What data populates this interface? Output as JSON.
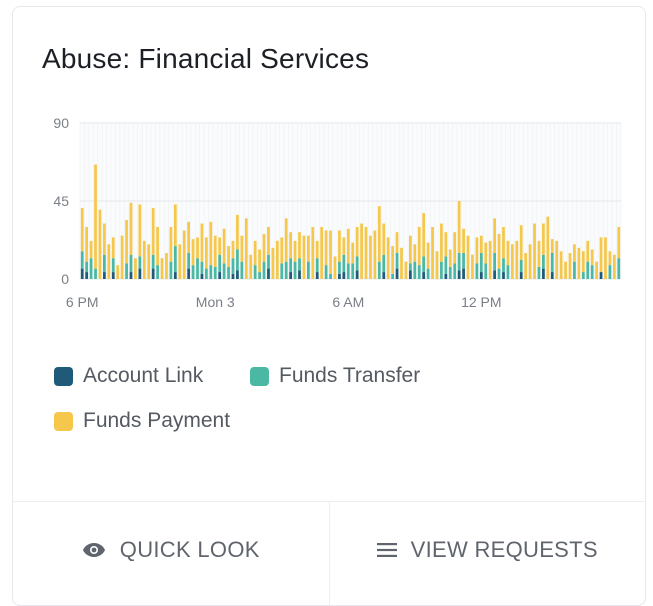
{
  "card": {
    "title": "Abuse: Financial Services"
  },
  "colors": {
    "account_link": "#1f5b78",
    "funds_transfer": "#4bb8a3",
    "funds_payment": "#f5c84c",
    "grid": "#eef0f3"
  },
  "legend": [
    {
      "label": "Account Link",
      "color": "#1f5b78"
    },
    {
      "label": "Funds Transfer",
      "color": "#4bb8a3"
    },
    {
      "label": "Funds Payment",
      "color": "#f5c84c"
    }
  ],
  "actions": {
    "quick_look": {
      "label": "QUICK LOOK",
      "icon": "eye-icon"
    },
    "view_requests": {
      "label": "VIEW REQUESTS",
      "icon": "list-icon"
    }
  },
  "chart_data": {
    "type": "bar",
    "stacked": true,
    "ylim": [
      0,
      90
    ],
    "yticks": [
      "0",
      "45",
      "90"
    ],
    "xticks": [
      {
        "label": "6 PM",
        "index": 0
      },
      {
        "label": "Mon 3",
        "index": 30
      },
      {
        "label": "6 AM",
        "index": 60
      },
      {
        "label": "12 PM",
        "index": 90
      }
    ],
    "grid": true,
    "legend_position": "bottom",
    "series": [
      {
        "name": "Account Link",
        "values": [
          6,
          4,
          0,
          0,
          0,
          4,
          0,
          4,
          0,
          0,
          0,
          4,
          0,
          6,
          0,
          0,
          6,
          0,
          0,
          0,
          0,
          4,
          0,
          0,
          6,
          0,
          0,
          3,
          0,
          0,
          0,
          4,
          0,
          0,
          3,
          5,
          0,
          0,
          0,
          0,
          0,
          0,
          6,
          0,
          0,
          0,
          0,
          4,
          0,
          5,
          0,
          0,
          0,
          4,
          0,
          0,
          0,
          0,
          3,
          4,
          0,
          0,
          5,
          0,
          0,
          0,
          0,
          0,
          4,
          0,
          0,
          6,
          0,
          0,
          5,
          0,
          0,
          4,
          0,
          0,
          0,
          0,
          3,
          0,
          0,
          5,
          6,
          0,
          0,
          0,
          4,
          0,
          0,
          5,
          0,
          4,
          0,
          0,
          0,
          4,
          0,
          0,
          0,
          0,
          6,
          0,
          4,
          0,
          0,
          0,
          0,
          0,
          0,
          0,
          0,
          0,
          0,
          4,
          0,
          0,
          0,
          0
        ]
      },
      {
        "name": "Funds Transfer",
        "values": [
          10,
          6,
          12,
          6,
          0,
          10,
          0,
          8,
          0,
          0,
          9,
          10,
          0,
          7,
          0,
          0,
          8,
          8,
          0,
          0,
          10,
          15,
          0,
          0,
          9,
          8,
          12,
          7,
          6,
          8,
          7,
          10,
          9,
          7,
          9,
          12,
          10,
          0,
          0,
          8,
          4,
          10,
          8,
          0,
          0,
          9,
          10,
          8,
          10,
          7,
          0,
          10,
          0,
          8,
          0,
          8,
          3,
          0,
          7,
          10,
          9,
          9,
          8,
          0,
          0,
          0,
          0,
          10,
          10,
          0,
          3,
          9,
          0,
          0,
          4,
          10,
          8,
          9,
          6,
          0,
          0,
          10,
          10,
          7,
          9,
          10,
          9,
          0,
          0,
          9,
          11,
          9,
          0,
          10,
          6,
          8,
          8,
          0,
          0,
          7,
          0,
          0,
          0,
          7,
          8,
          0,
          11,
          0,
          0,
          0,
          0,
          10,
          0,
          4,
          10,
          8,
          0,
          0,
          0,
          8,
          0,
          12
        ]
      },
      {
        "name": "Funds Payment",
        "values": [
          25,
          20,
          10,
          60,
          40,
          18,
          20,
          12,
          8,
          25,
          25,
          30,
          12,
          30,
          22,
          20,
          27,
          22,
          12,
          15,
          20,
          24,
          20,
          28,
          18,
          15,
          12,
          22,
          18,
          25,
          18,
          10,
          20,
          12,
          10,
          20,
          15,
          35,
          14,
          14,
          13,
          16,
          16,
          18,
          22,
          15,
          25,
          15,
          12,
          15,
          25,
          15,
          30,
          10,
          30,
          20,
          25,
          13,
          18,
          10,
          20,
          12,
          17,
          32,
          30,
          25,
          28,
          32,
          18,
          24,
          16,
          12,
          18,
          10,
          16,
          10,
          22,
          25,
          15,
          30,
          16,
          22,
          14,
          10,
          18,
          30,
          14,
          25,
          14,
          15,
          10,
          12,
          22,
          20,
          20,
          18,
          14,
          20,
          22,
          20,
          15,
          20,
          32,
          15,
          18,
          36,
          8,
          22,
          16,
          10,
          15,
          10,
          18,
          12,
          12,
          9,
          10,
          20,
          24,
          8,
          14,
          18
        ]
      }
    ]
  }
}
